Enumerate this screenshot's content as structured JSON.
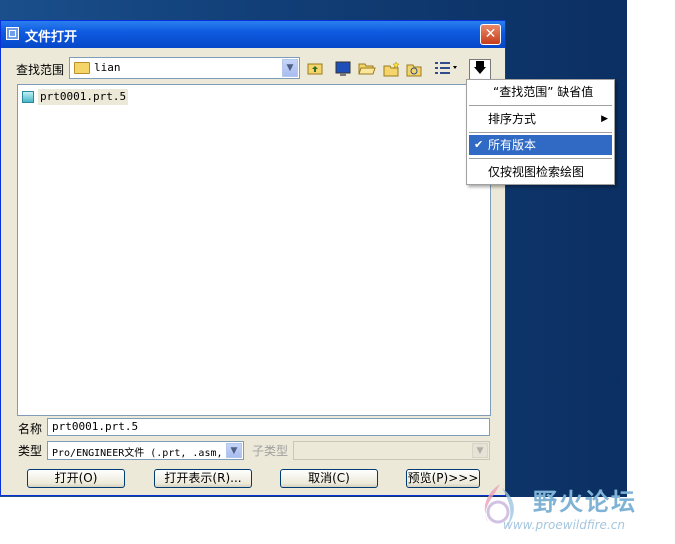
{
  "dialog": {
    "title": "文件打开",
    "close_label": "✕"
  },
  "lookin": {
    "label": "查找范围",
    "value": "lian"
  },
  "toolbar": {
    "icons": [
      "folder-up-icon",
      "desktop-icon",
      "open-folder-icon",
      "new-folder-icon",
      "working-dir-icon",
      "view-list-icon",
      "tools-dropdown-icon"
    ]
  },
  "files": [
    {
      "name": "prt0001.prt.5"
    }
  ],
  "filename": {
    "label": "名称",
    "value": "prt0001.prt.5"
  },
  "filetype": {
    "label": "类型",
    "value": "Pro/ENGINEER文件 (.prt, .asm,"
  },
  "subtype": {
    "label": "子类型",
    "value": ""
  },
  "buttons": {
    "open": "打开(O)",
    "open_rep": "打开表示(R)...",
    "cancel": "取消(C)",
    "preview": "预览(P)>>>"
  },
  "menu": {
    "items": [
      {
        "label": "“查找范围” 缺省值"
      },
      {
        "label": "排序方式"
      },
      {
        "label": "所有版本",
        "checked": true
      },
      {
        "label": "仅按视图检索绘图"
      }
    ]
  },
  "watermark": {
    "text": "野火论坛",
    "url": "www.proewildfire.cn"
  },
  "colors": {
    "titlebar": "#0e5be0",
    "dialog_bg": "#ece9d8",
    "menu_selected": "#316ac5"
  }
}
